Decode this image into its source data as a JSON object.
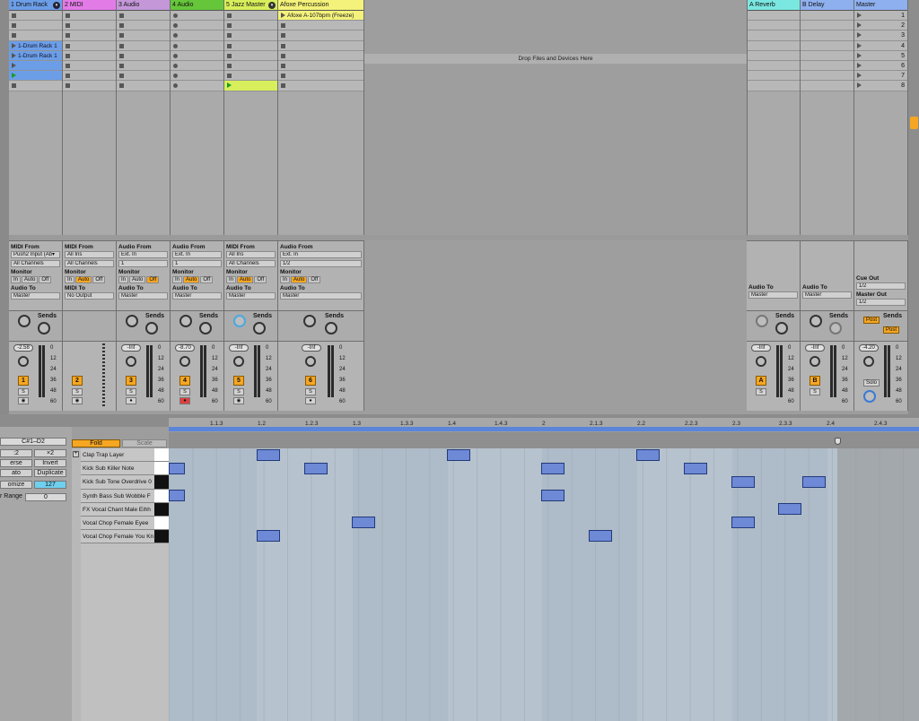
{
  "tracks": [
    {
      "name": "1 Drum Rack",
      "color": "#6c9ee8",
      "clips": [
        "1-Drum Rack 1",
        "1-Drum Rack 1"
      ],
      "vol": "-2.58",
      "num": "1",
      "io_from_label": "MIDI From",
      "io_from": "Push2 Input (Ab▾",
      "io_ch": "All Channels",
      "io_to": "Master"
    },
    {
      "name": "2 MIDI",
      "color": "#e37be6",
      "vol": "",
      "num": "2",
      "io_from_label": "MIDI From",
      "io_from": "All Ins",
      "io_ch": "All Channels",
      "io_to": "No Output",
      "io_to_label": "MIDI To"
    },
    {
      "name": "3 Audio",
      "color": "#c497d9",
      "vol": "-Inf",
      "num": "3",
      "io_from_label": "Audio From",
      "io_from": "Ext. In",
      "io_ch": "1",
      "io_to": "Master"
    },
    {
      "name": "4 Audio",
      "color": "#66c63a",
      "vol": "-8.70",
      "num": "4",
      "io_from_label": "Audio From",
      "io_from": "Ext. In",
      "io_ch": "1",
      "io_to": "Master"
    },
    {
      "name": "5 Jazz Master",
      "color": "#d8ef5b",
      "vol": "-Inf",
      "num": "5",
      "io_from_label": "MIDI From",
      "io_from": "All Ins",
      "io_ch": "All Channels",
      "io_to": "Master"
    },
    {
      "name": "Afoxe Percussion",
      "color": "#f4f27a",
      "clip": "Afoxe A-107bpm (Freeze)",
      "vol": "-Inf",
      "num": "6",
      "io_from_label": "Audio From",
      "io_from": "Ext. In",
      "io_ch": "1/2",
      "io_to": "Master"
    }
  ],
  "returns": [
    {
      "name": "A Reverb",
      "color": "#7ae8e0",
      "vol": "-Inf",
      "num": "A",
      "io_to": "Master"
    },
    {
      "name": "B Delay",
      "color": "#8fb0ef",
      "vol": "-Inf",
      "num": "B",
      "io_to": "Master"
    }
  ],
  "master": {
    "name": "Master",
    "color": "#8fb0ef",
    "vol": "-4.20",
    "cue_out_label": "Cue Out",
    "cue_out": "1/2",
    "master_out_label": "Master Out",
    "master_out": "1/2",
    "post": "Post",
    "solo": "Solo"
  },
  "labels": {
    "drop": "Drop Files and Devices Here",
    "monitor": "Monitor",
    "audio_to": "Audio To",
    "sends": "Sends",
    "in": "In",
    "auto": "Auto",
    "off": "Off",
    "solo_s": "S",
    "a": "A",
    "b": "B"
  },
  "scene_numbers": [
    "1",
    "2",
    "3",
    "4",
    "5",
    "6",
    "7",
    "8"
  ],
  "meter_scale": [
    "0",
    "12",
    "24",
    "36",
    "48",
    "60"
  ],
  "clip_view": {
    "range": "C#1–D2",
    "btn_2": ":2",
    "btn_x2": "×2",
    "btn_reverse": "erse",
    "btn_invert": "Invert",
    "btn_legato": "ato",
    "btn_duplicate": "Duplicate",
    "btn_randomize": "omize",
    "vel": "127",
    "vel_range_label": "r Range",
    "vel_range": "0",
    "fold": "Fold",
    "scale": "Scale",
    "rows": [
      "Clap Trap Layer",
      "Kick Sub Killer Note",
      "Kick Sub Tone Overdrive 0",
      "Synth Bass Sub Wobble F",
      "FX Vocal Chant Male Eihh",
      "Vocal Chop Female Eyee",
      "Vocal Chop Female You Kn"
    ],
    "ruler": [
      "1.1.3",
      "1.2",
      "1.2.3",
      "1.3",
      "1.3.3",
      "1.4",
      "1.4.3",
      "2",
      "2.1.3",
      "2.2",
      "2.2.3",
      "2.3",
      "2.3.3",
      "2.4",
      "2.4.3"
    ]
  },
  "colors": {
    "orange": "#f5a623",
    "note": "#6e8ad6"
  }
}
